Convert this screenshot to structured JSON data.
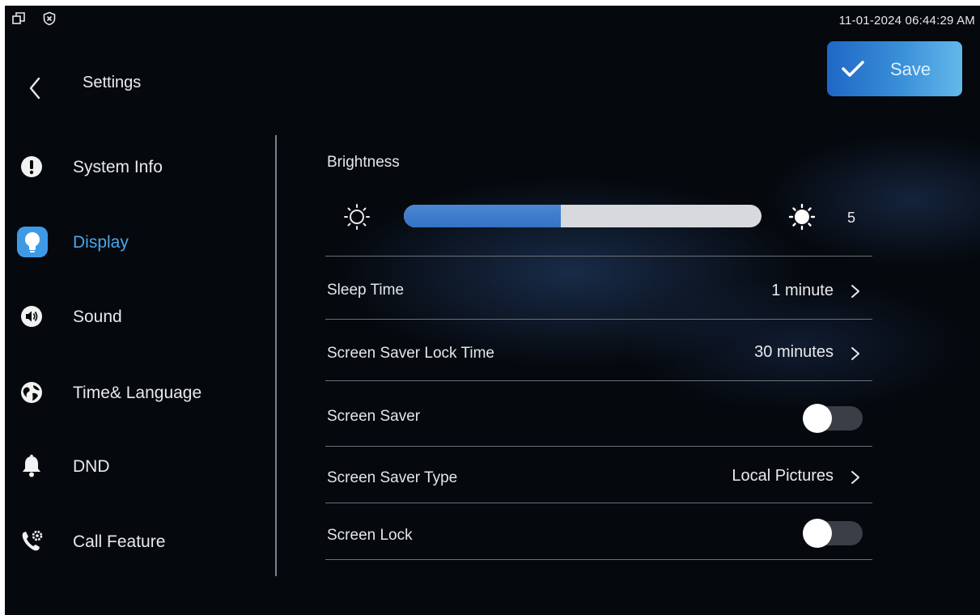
{
  "status_bar": {
    "left_icons": [
      "window-icon",
      "shield-x-icon"
    ],
    "datetime": "11-01-2024 06:44:29 AM"
  },
  "header": {
    "title": "Settings",
    "save_label": "Save"
  },
  "sidebar": {
    "items": [
      {
        "label": "System Info",
        "icon": "info-icon",
        "active": false
      },
      {
        "label": "Display",
        "icon": "lightbulb-icon",
        "active": true
      },
      {
        "label": "Sound",
        "icon": "speaker-icon",
        "active": false
      },
      {
        "label": "Time& Language",
        "icon": "globe-icon",
        "active": false
      },
      {
        "label": "DND",
        "icon": "bell-icon",
        "active": false
      },
      {
        "label": "Call Feature",
        "icon": "phone-gear-icon",
        "active": false
      }
    ]
  },
  "display": {
    "brightness": {
      "label": "Brightness",
      "value": "5",
      "fill_fraction": 0.44
    },
    "rows": [
      {
        "label": "Sleep Time",
        "value": "1 minute",
        "type": "select"
      },
      {
        "label": "Screen Saver Lock Time",
        "value": "30 minutes",
        "type": "select"
      },
      {
        "label": "Screen Saver",
        "value": "off",
        "type": "toggle"
      },
      {
        "label": "Screen Saver Type",
        "value": "Local Pictures",
        "type": "select"
      },
      {
        "label": "Screen Lock",
        "value": "off",
        "type": "toggle"
      }
    ]
  },
  "colors": {
    "accent": "#4aa6ee",
    "slider_fill": "#3a79c8",
    "background": "#05080d"
  }
}
